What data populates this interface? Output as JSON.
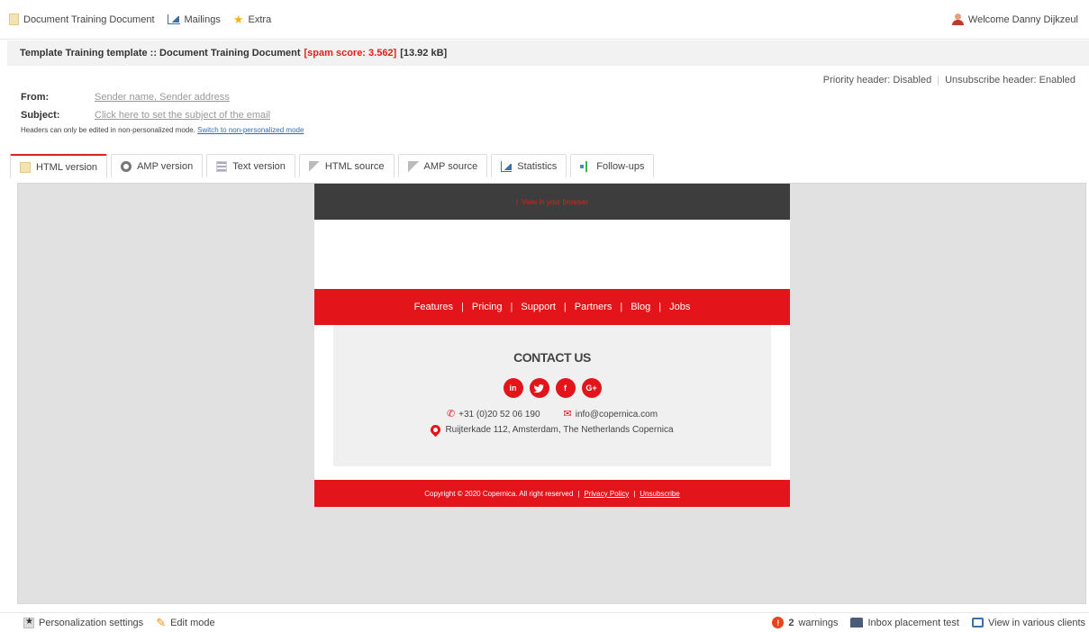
{
  "topbar": {
    "menu": [
      {
        "label": "Document Training Document",
        "icon": "document-icon"
      },
      {
        "label": "Mailings",
        "icon": "chart-icon"
      },
      {
        "label": "Extra",
        "icon": "star-icon"
      }
    ],
    "welcome": "Welcome Danny Dijkzeul"
  },
  "titlebar": {
    "title": "Template Training template :: Document Training Document",
    "spam": "[spam score: 3.562]",
    "size": "[13.92 kB]"
  },
  "headers_info": {
    "priority": "Priority header: Disabled",
    "separator": "|",
    "unsubscribe": "Unsubscribe header: Enabled"
  },
  "fields": {
    "from_label": "From:",
    "from_value": "Sender name, Sender address",
    "subject_label": "Subject:",
    "subject_value": "Click here to set the subject of the email"
  },
  "note": {
    "text": "Headers can only be edited in non-personalized mode.",
    "link": "Switch to non-personalized mode"
  },
  "tabs": [
    {
      "label": "HTML version",
      "icon": "document-icon",
      "active": true
    },
    {
      "label": "AMP version",
      "icon": "gear-icon"
    },
    {
      "label": "Text version",
      "icon": "text-icon"
    },
    {
      "label": "HTML source",
      "icon": "source-icon"
    },
    {
      "label": "AMP source",
      "icon": "source-icon"
    },
    {
      "label": "Statistics",
      "icon": "chart-icon"
    },
    {
      "label": "Follow-ups",
      "icon": "follow-ups-icon"
    }
  ],
  "email": {
    "header_pipe": "|",
    "header_link": "View in your browser",
    "nav": [
      "Features",
      "Pricing",
      "Support",
      "Partners",
      "Blog",
      "Jobs"
    ],
    "nav_sep": "|",
    "contact_title": "CONTACT US",
    "socials": [
      "in",
      "t",
      "f",
      "G+"
    ],
    "phone": "+31 (0)20 52 06 190",
    "email": "info@copernica.com",
    "address": "Ruijterkade 112, Amsterdam, The Netherlands Copernica",
    "footer_text": "Copyright © 2020 Copernica. All right reserved",
    "footer_sep": "|",
    "footer_privacy": "Privacy Policy",
    "footer_unsubscribe": "Unsubscribe"
  },
  "bottombar": {
    "personalization": "Personalization settings",
    "edit_mode": "Edit mode",
    "warnings_count": "2",
    "warnings_label": "warnings",
    "inbox_test": "Inbox placement test",
    "view_clients": "View in various clients"
  },
  "colors": {
    "accent_red": "#e3141a",
    "spam_red": "#e0201a",
    "header_dark": "#3d3d3d"
  }
}
